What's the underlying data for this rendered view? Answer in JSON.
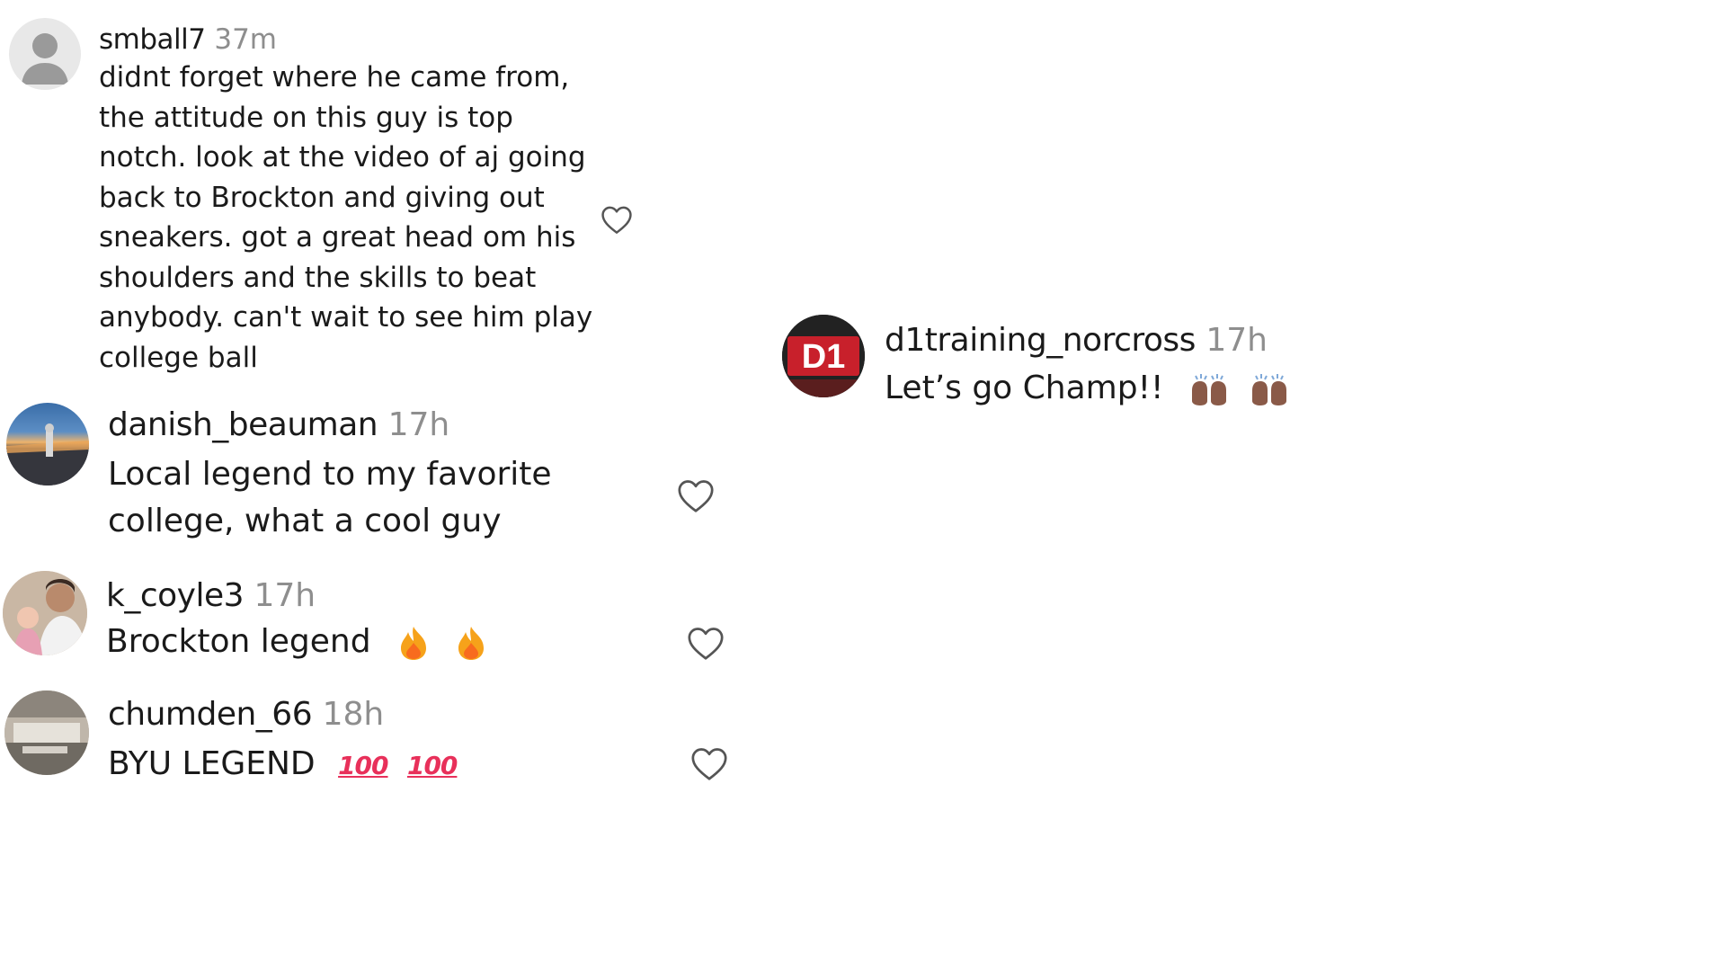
{
  "comments": [
    {
      "username": "smball7",
      "time": "37m",
      "lines": [
        "didnt forget where he came from,",
        "the attitude on this guy is top",
        "notch. look at the video of aj going",
        "back to Brockton and giving out",
        "sneakers. got a great head om his",
        "shoulders and the skills to beat",
        "anybody. can't wait to see him play",
        "college ball"
      ]
    },
    {
      "username": "danish_beauman",
      "time": "17h",
      "lines": [
        "Local legend to my favorite",
        "college, what a cool guy"
      ]
    },
    {
      "username": "k_coyle3",
      "time": "17h",
      "text": "Brockton legend"
    },
    {
      "username": "chumden_66",
      "time": "18h",
      "text": "BYU LEGEND",
      "emoji_text": "100"
    },
    {
      "username": "d1training_norcross",
      "time": "17h",
      "text": "Let’s go Champ!!",
      "avatar_text": "D1"
    }
  ],
  "icons": {
    "like": "heart-outline-icon",
    "default_avatar": "user-silhouette-icon",
    "fire": "fire-emoji-icon",
    "hundred": "hundred-points-emoji-icon",
    "raised_hands": "raised-hands-emoji-icon"
  },
  "colors": {
    "text": "#1a1a1a",
    "muted": "#8e8e8e",
    "d1_red": "#c8202b",
    "hundred_red": "#e8305a"
  }
}
